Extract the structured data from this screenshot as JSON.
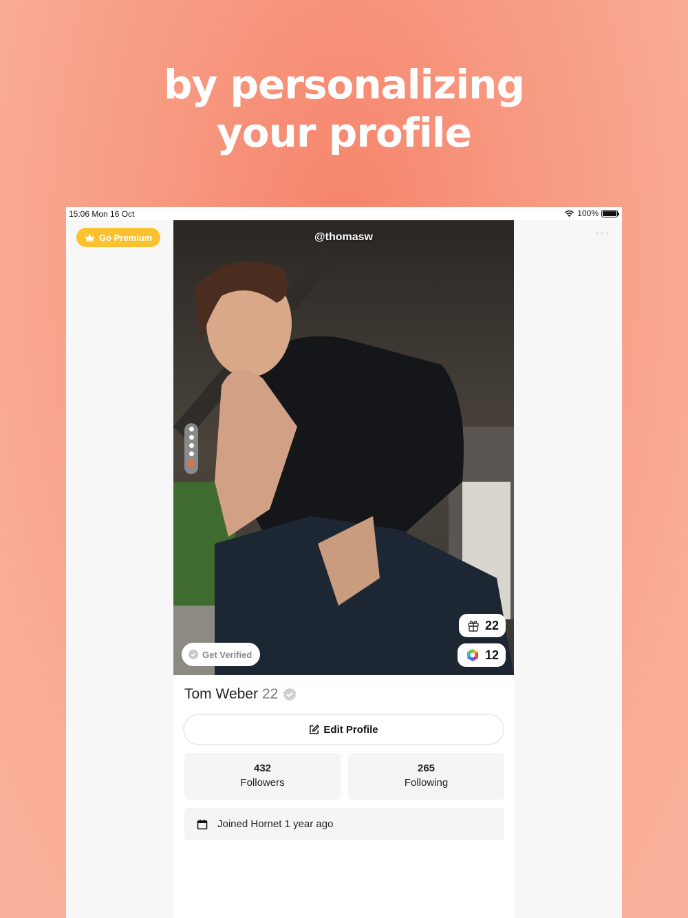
{
  "headline": {
    "line1": "by personalizing",
    "line2": "your profile"
  },
  "statusbar": {
    "time": "15:06 Mon 16 Oct",
    "battery": "100%"
  },
  "toolbar": {
    "premium_label": "Go Premium"
  },
  "profile": {
    "username": "@thomasw",
    "name": "Tom Weber",
    "age": "22",
    "verify_label": "Get Verified",
    "gifts_count": "22",
    "points_count": "12",
    "edit_label": "Edit Profile",
    "followers_count": "432",
    "followers_label": "Followers",
    "following_count": "265",
    "following_label": "Following",
    "joined_text": "Joined Hornet 1 year ago"
  },
  "colors": {
    "background": "#f7977f",
    "premium": "#f9c22e",
    "lock": "#f26b3a"
  },
  "icons": [
    "wifi-icon",
    "battery-icon",
    "crown-icon",
    "more-icon",
    "lock-icon",
    "check-circle-icon",
    "gift-icon",
    "points-icon",
    "verified-badge-icon",
    "edit-icon",
    "calendar-icon"
  ]
}
